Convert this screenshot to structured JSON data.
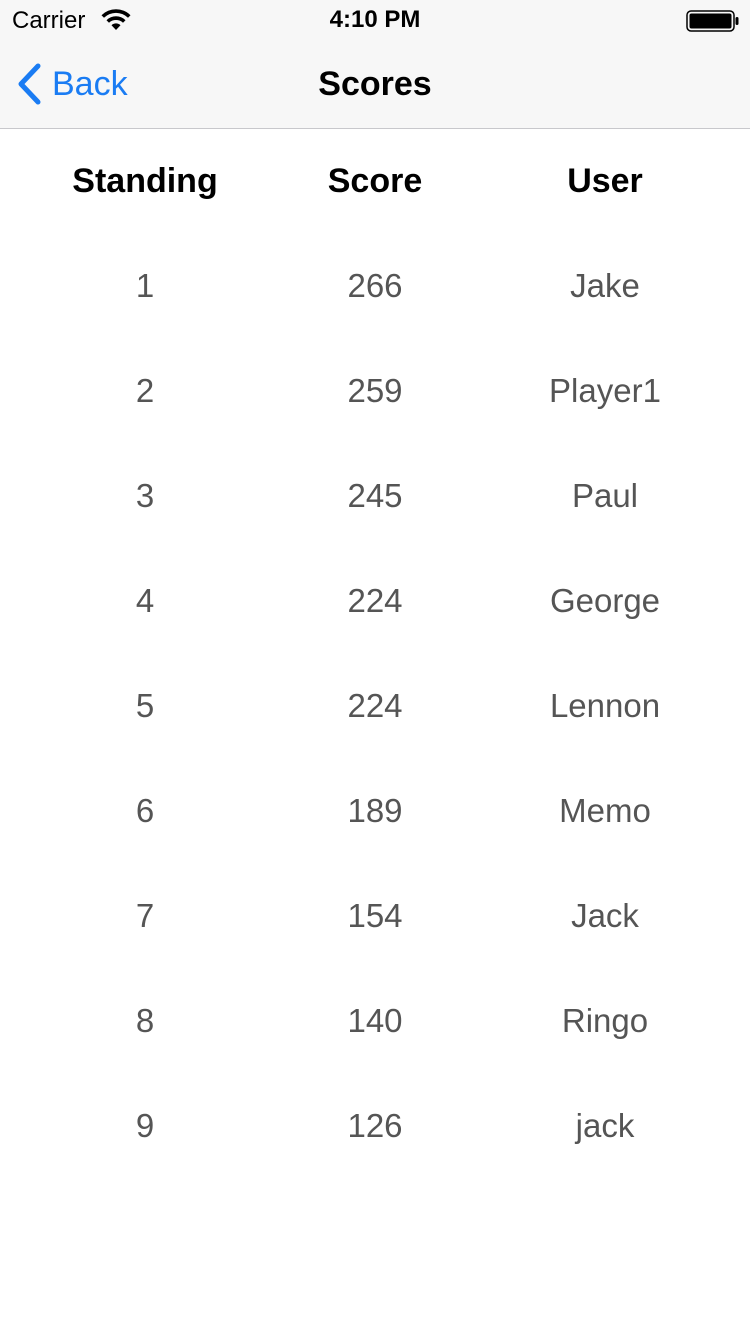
{
  "status_bar": {
    "carrier": "Carrier",
    "time": "4:10 PM",
    "icons": [
      "wifi-icon",
      "battery-icon"
    ]
  },
  "nav": {
    "back_label": "Back",
    "title": "Scores",
    "accent_color": "#1a7cf3"
  },
  "table": {
    "headers": [
      "Standing",
      "Score",
      "User"
    ],
    "rows": [
      {
        "standing": "1",
        "score": "266",
        "user": "Jake"
      },
      {
        "standing": "2",
        "score": "259",
        "user": "Player1"
      },
      {
        "standing": "3",
        "score": "245",
        "user": "Paul"
      },
      {
        "standing": "4",
        "score": "224",
        "user": "George"
      },
      {
        "standing": "5",
        "score": "224",
        "user": "Lennon"
      },
      {
        "standing": "6",
        "score": "189",
        "user": "Memo"
      },
      {
        "standing": "7",
        "score": "154",
        "user": "Jack"
      },
      {
        "standing": "8",
        "score": "140",
        "user": "Ringo"
      },
      {
        "standing": "9",
        "score": "126",
        "user": "jack"
      }
    ]
  }
}
